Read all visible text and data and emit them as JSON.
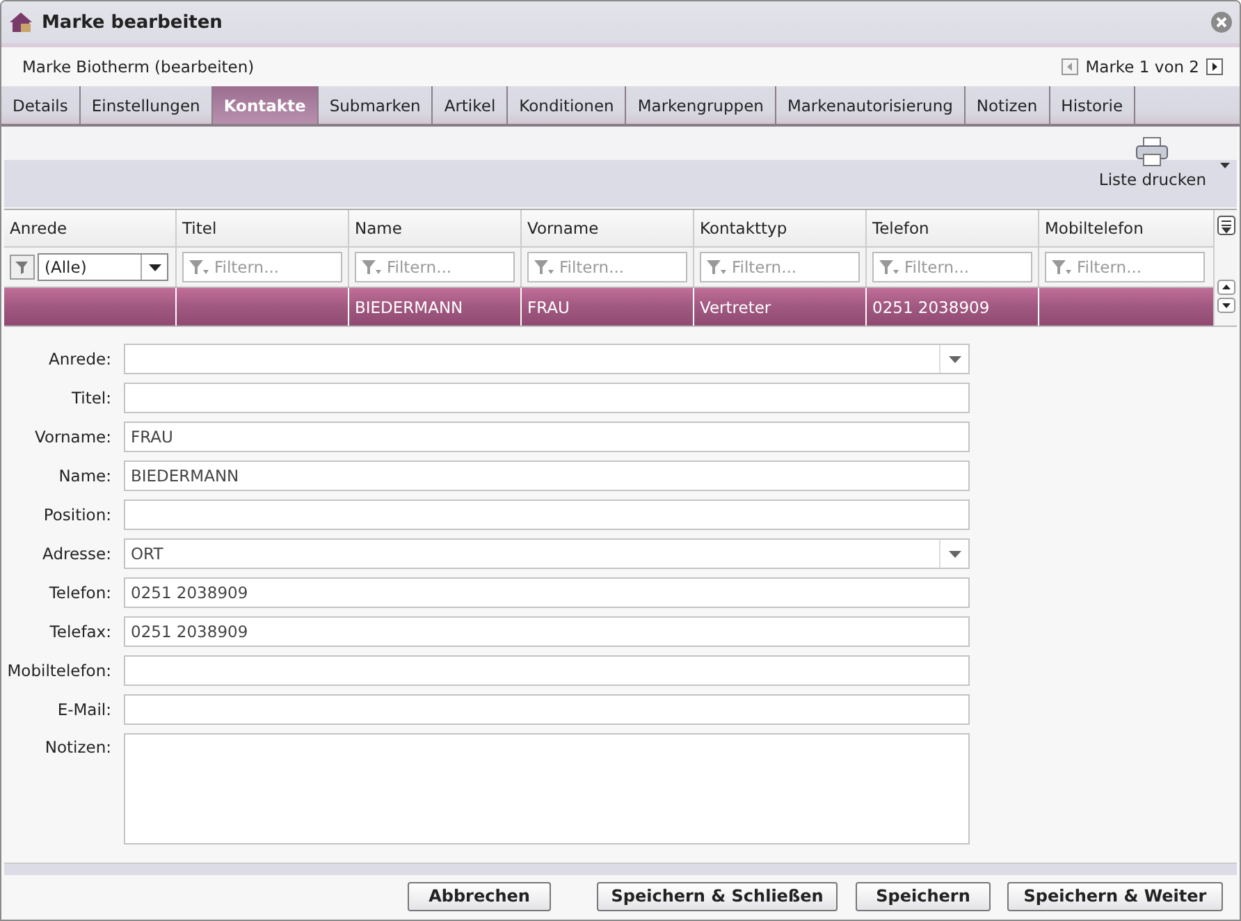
{
  "window": {
    "title": "Marke bearbeiten"
  },
  "header": {
    "title": "Marke Biotherm (bearbeiten)",
    "pager": "Marke 1 von 2"
  },
  "tabs": [
    {
      "label": "Details",
      "selected": false
    },
    {
      "label": "Einstellungen",
      "selected": false
    },
    {
      "label": "Kontakte",
      "selected": true
    },
    {
      "label": "Submarken",
      "selected": false
    },
    {
      "label": "Artikel",
      "selected": false
    },
    {
      "label": "Konditionen",
      "selected": false
    },
    {
      "label": "Markengruppen",
      "selected": false
    },
    {
      "label": "Markenautorisierung",
      "selected": false
    },
    {
      "label": "Notizen",
      "selected": false
    },
    {
      "label": "Historie",
      "selected": false
    }
  ],
  "toolbar": {
    "print_button": "Liste drucken"
  },
  "table": {
    "columns": [
      "Anrede",
      "Titel",
      "Name",
      "Vorname",
      "Kontakttyp",
      "Telefon",
      "Mobiltelefon"
    ],
    "filters": [
      {
        "kind": "combo",
        "value": "(Alle)"
      },
      {
        "kind": "text",
        "placeholder": "Filtern..."
      },
      {
        "kind": "text",
        "placeholder": "Filtern..."
      },
      {
        "kind": "text",
        "placeholder": "Filtern..."
      },
      {
        "kind": "text",
        "placeholder": "Filtern..."
      },
      {
        "kind": "text",
        "placeholder": "Filtern..."
      },
      {
        "kind": "text",
        "placeholder": "Filtern..."
      }
    ],
    "rows": [
      {
        "selected": true,
        "cells": [
          "",
          "",
          "BIEDERMANN",
          "FRAU",
          "Vertreter",
          "0251 2038909",
          ""
        ]
      }
    ]
  },
  "form": [
    {
      "label": "Anrede:",
      "kind": "combo"
    },
    {
      "label": "Titel:",
      "kind": "text"
    },
    {
      "label": "Vorname:",
      "kind": "text",
      "value": "FRAU"
    },
    {
      "label": "Name:",
      "kind": "text",
      "value": "BIEDERMANN"
    },
    {
      "label": "Position:",
      "kind": "text"
    },
    {
      "label": "Adresse:",
      "kind": "combo",
      "value": "ORT"
    },
    {
      "label": "Telefon:",
      "kind": "text",
      "value": "0251 2038909"
    },
    {
      "label": "Telefax:",
      "kind": "text",
      "value": "0251 2038909"
    },
    {
      "label": "Mobiltelefon:",
      "kind": "text"
    },
    {
      "label": "E-Mail:",
      "kind": "text"
    },
    {
      "label": "Notizen:",
      "kind": "textarea"
    }
  ],
  "buttons": [
    "Abbrechen",
    "Speichern & Schließen",
    "Speichern",
    "Speichern & Weiter"
  ]
}
